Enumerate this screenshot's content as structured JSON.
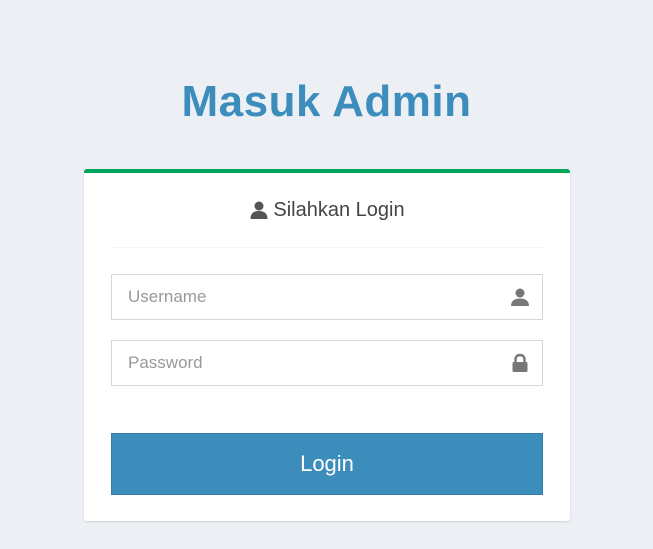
{
  "page": {
    "title": "Masuk Admin"
  },
  "login_box": {
    "header_icon": "user-icon",
    "header_text": "Silahkan Login",
    "username": {
      "placeholder": "Username",
      "value": "",
      "icon": "user-icon"
    },
    "password": {
      "placeholder": "Password",
      "value": "",
      "icon": "lock-icon"
    },
    "submit_label": "Login"
  },
  "colors": {
    "background": "#ecf0f5",
    "title": "#3c8dbc",
    "box_top_border": "#00a65a",
    "button": "#3c8dbc"
  }
}
